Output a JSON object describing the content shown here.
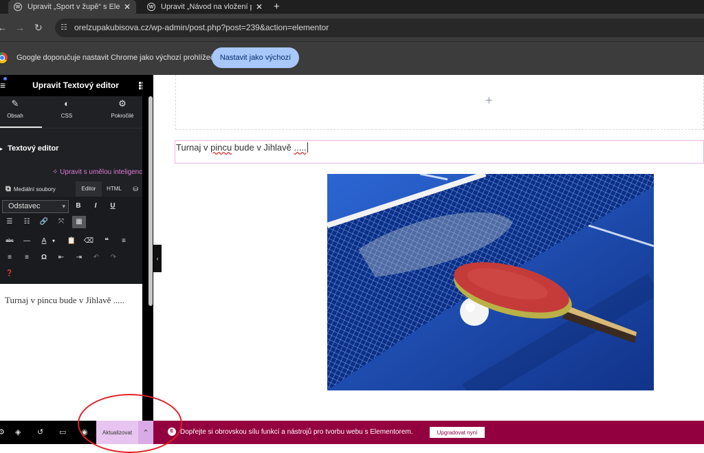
{
  "browser": {
    "tabs": [
      {
        "title": "Upravit „Sport v župě“ s Elementorem"
      },
      {
        "title": "Upravit „Návod na vložení příspěvku“"
      }
    ],
    "url": "orelzupakubisova.cz/wp-admin/post.php?post=239&action=elementor",
    "infobar_text": "Google doporučuje nastavit Chrome jako výchozí prohlížeč",
    "infobar_button": "Nastavit jako výchozí"
  },
  "panel": {
    "title": "Upravit Textový editor",
    "tabs": [
      {
        "label": "Obsah",
        "icon": "pencil-icon"
      },
      {
        "label": "CSS",
        "icon": "css-icon"
      },
      {
        "label": "Pokročilé",
        "icon": "gear-icon"
      }
    ],
    "section_title": "Textový editor",
    "ai_button": "Upravit s umělou inteligencí",
    "media_button": "Mediální soubory",
    "editor_tab": "Editor",
    "html_tab": "HTML",
    "format_select": "Odstavec",
    "editor_content": "Turnaj v pincu bude v Jihlavě ....."
  },
  "canvas": {
    "text_widget": {
      "before": "Turnaj v ",
      "misspelled": "pincu",
      "after": " bude v Jihlavě ",
      "dots": "....."
    }
  },
  "footer": {
    "update_button": "Aktualizovat",
    "promo_text": "Dopřejte si obrovskou sílu funkcí a nástrojů pro tvorbu webu s Elementorem.",
    "upgrade_button": "Upgradovat nyní"
  },
  "colors": {
    "promo_bg": "#93003f",
    "update_bg": "#e8c5f0",
    "ai_accent": "#e07ad8",
    "chrome_button": "#a8c7fa"
  }
}
